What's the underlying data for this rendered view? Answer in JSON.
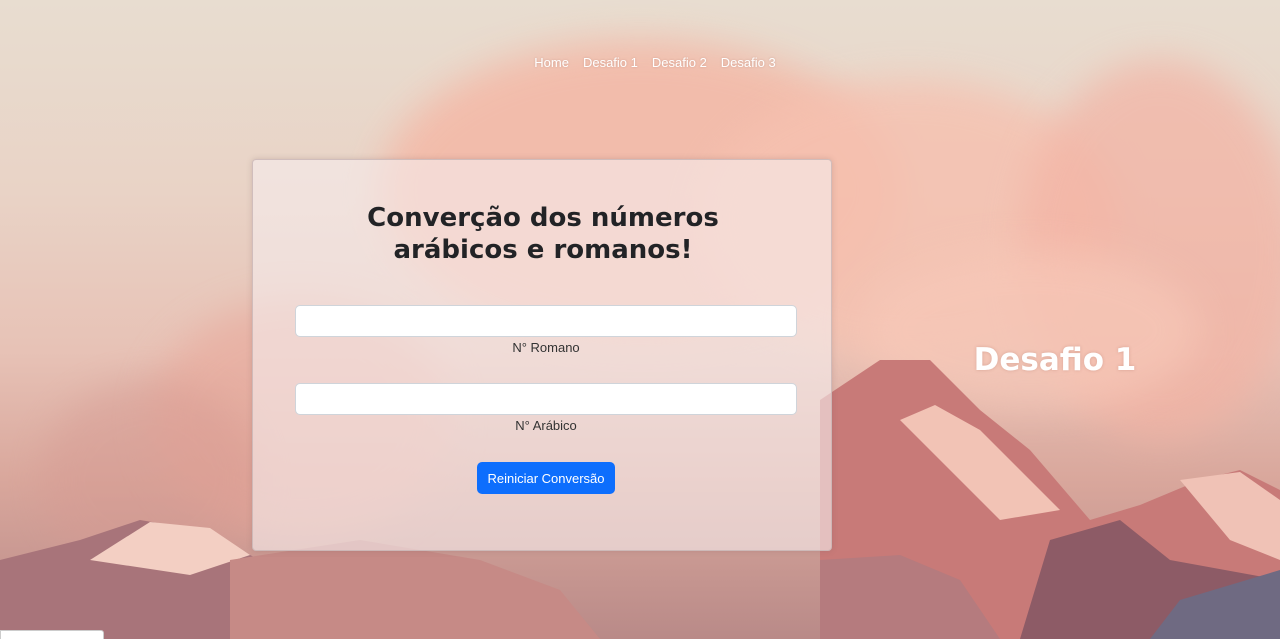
{
  "nav": {
    "items": [
      {
        "label": "Home"
      },
      {
        "label": "Desafio 1"
      },
      {
        "label": "Desafio 2"
      },
      {
        "label": "Desafio 3"
      }
    ]
  },
  "card": {
    "title": "Converção dos números arábicos e romanos!",
    "roman_field": {
      "value": "",
      "label": "N° Romano"
    },
    "arabic_field": {
      "value": "",
      "label": "N° Arábico"
    },
    "reset_button": "Reiniciar Conversão"
  },
  "hero": {
    "title": "Desafio 1"
  },
  "colors": {
    "button": "#0d6efd",
    "title_text": "#222326"
  }
}
